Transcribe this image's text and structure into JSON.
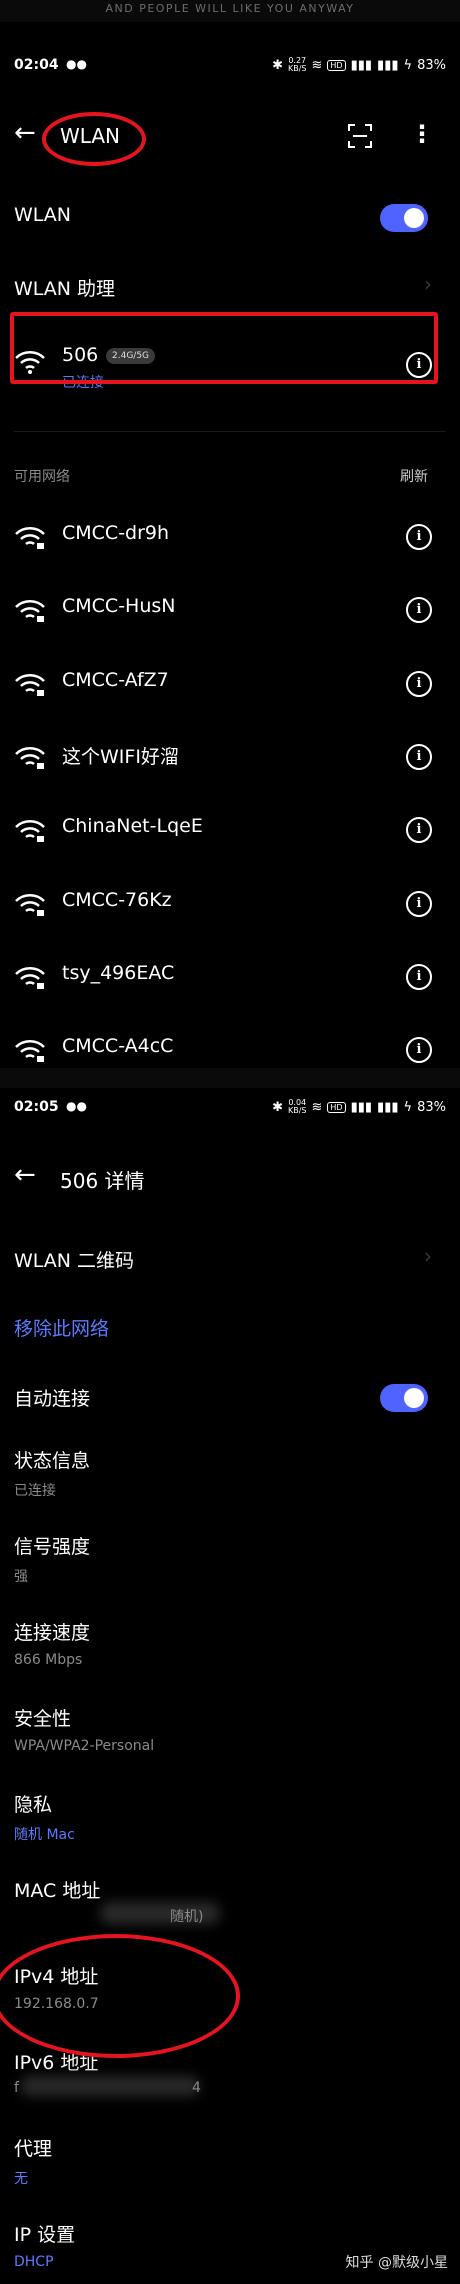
{
  "banner": {
    "text": "AND PEOPLE WILL LIKE YOU ANYWAY"
  },
  "screen1": {
    "status": {
      "time": "02:04",
      "speed_top": "0.27",
      "speed_unit": "KB/S",
      "hd": "HD",
      "battery": "83%"
    },
    "title": "WLAN",
    "wlan_toggle": {
      "label": "WLAN",
      "on": true
    },
    "assistant": {
      "label": "WLAN 助理"
    },
    "connected": {
      "ssid": "506",
      "band": "2.4G/5G",
      "status": "已连接"
    },
    "available": {
      "header": "可用网络",
      "refresh": "刷新"
    },
    "networks": [
      "CMCC-dr9h",
      "CMCC-HusN",
      "CMCC-AfZ7",
      "这个WIFI好溜",
      "ChinaNet-LqeE",
      "CMCC-76Kz",
      "tsy_496EAC",
      "CMCC-A4cC"
    ]
  },
  "screen2": {
    "status": {
      "time": "02:05",
      "speed_top": "0.04",
      "speed_unit": "KB/S",
      "hd": "HD",
      "battery": "83%"
    },
    "title": "506 详情",
    "qr": {
      "label": "WLAN 二维码"
    },
    "forget": {
      "label": "移除此网络"
    },
    "auto_connect": {
      "label": "自动连接",
      "on": true
    },
    "status_info": {
      "label": "状态信息",
      "value": "已连接"
    },
    "signal": {
      "label": "信号强度",
      "value": "强"
    },
    "speed": {
      "label": "连接速度",
      "value": "866 Mbps"
    },
    "security": {
      "label": "安全性",
      "value": "WPA/WPA2-Personal"
    },
    "privacy": {
      "label": "隐私",
      "value": "随机 Mac"
    },
    "mac": {
      "label": "MAC 地址",
      "value_tail": "随机)"
    },
    "ipv4": {
      "label": "IPv4 地址",
      "value": "192.168.0.7"
    },
    "ipv6": {
      "label": "IPv6 地址",
      "value_head": "f",
      "value_tail": "4"
    },
    "proxy": {
      "label": "代理",
      "value": "无"
    },
    "ip_settings": {
      "label": "IP 设置",
      "value": "DHCP"
    }
  },
  "watermark": "知乎 @默级小星",
  "colors": {
    "accent": "#4f63ff",
    "annotation": "#e5141e",
    "link": "#5b7bff"
  }
}
